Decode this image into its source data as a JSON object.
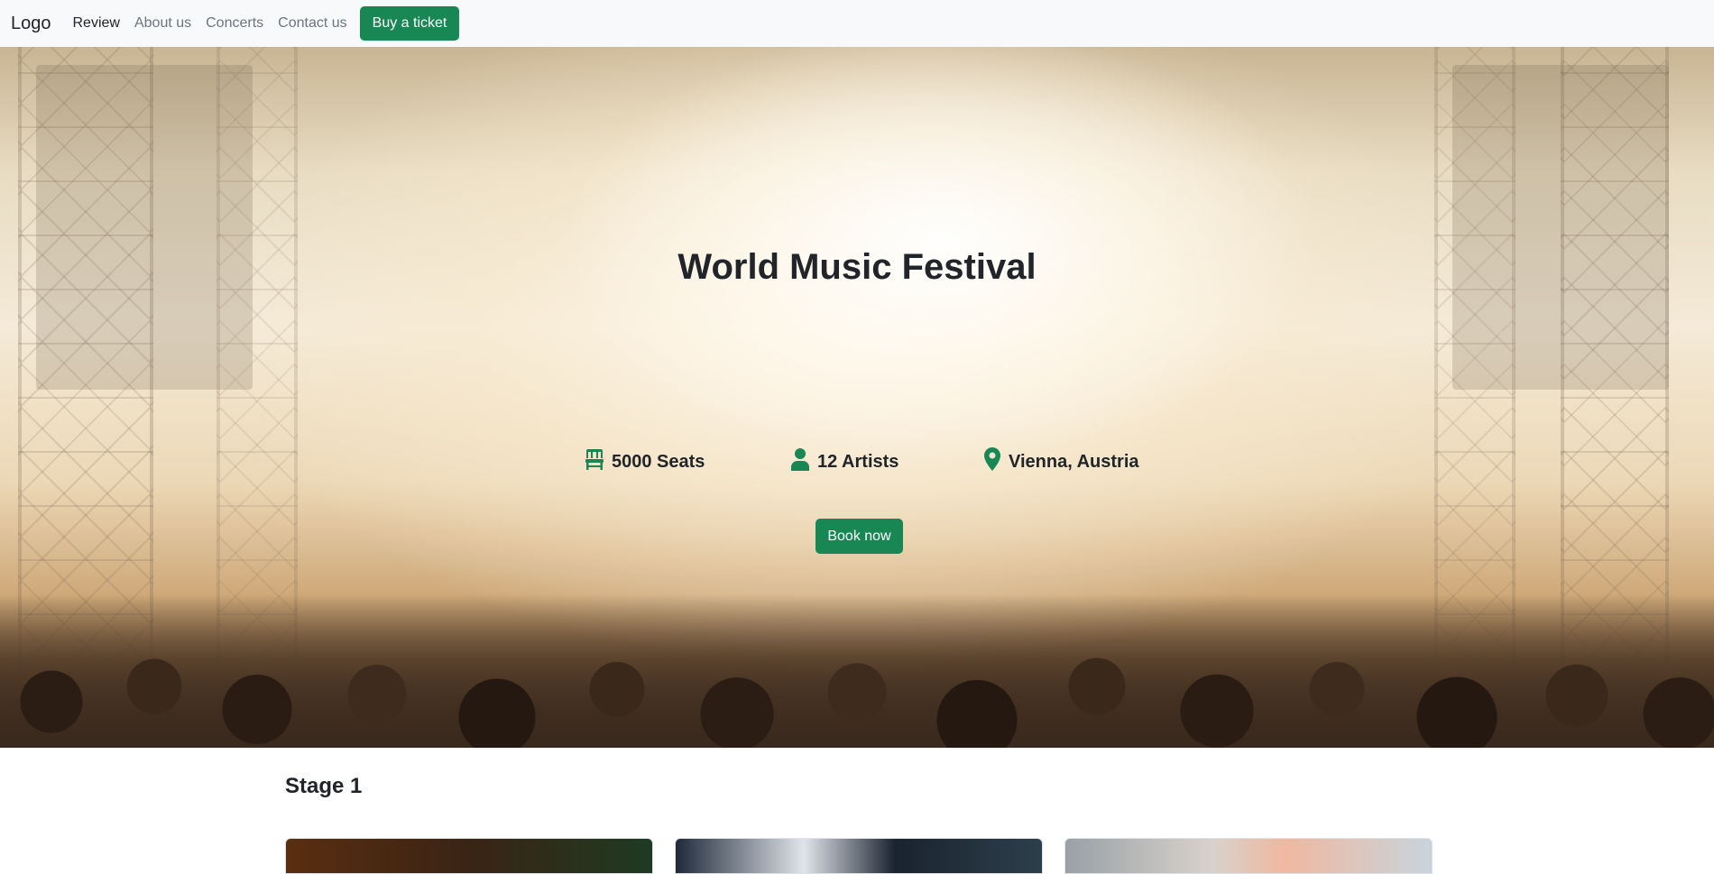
{
  "navbar": {
    "brand": "Logo",
    "links": [
      {
        "label": "Review",
        "active": true
      },
      {
        "label": "About us",
        "active": false
      },
      {
        "label": "Concerts",
        "active": false
      },
      {
        "label": "Contact us",
        "active": false
      }
    ],
    "cta_label": "Buy a ticket"
  },
  "hero": {
    "title": "World Music Festival",
    "stats": [
      {
        "icon": "chair-icon",
        "label": "5000 Seats"
      },
      {
        "icon": "person-icon",
        "label": "12 Artists"
      },
      {
        "icon": "map-pin-icon",
        "label": "Vienna, Austria"
      }
    ],
    "button_label": "Book now"
  },
  "stage": {
    "title": "Stage 1"
  },
  "colors": {
    "accent": "#198754",
    "navbar_bg": "#f8f9fa",
    "text": "#212529",
    "muted": "#6c757d"
  }
}
